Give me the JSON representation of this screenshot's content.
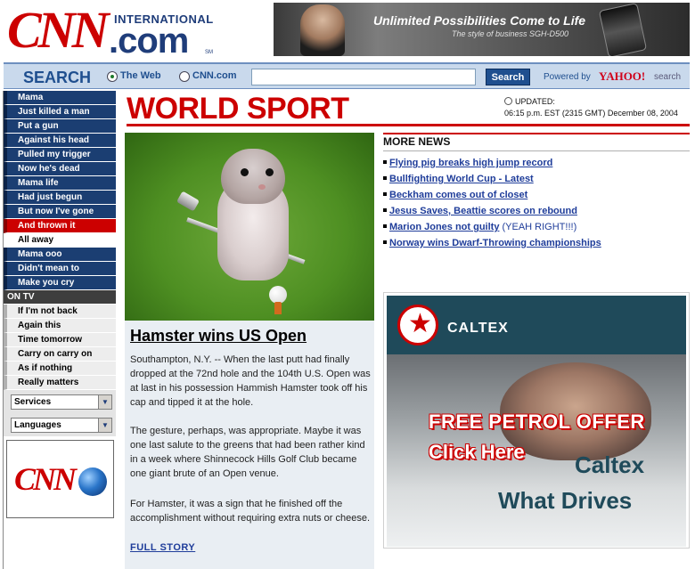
{
  "header": {
    "logo_cnn": "CNN",
    "logo_international": "INTERNATIONAL",
    "logo_dotcom": ".com",
    "logo_sm": "SM",
    "banner_title": "Unlimited Possibilities Come to Life",
    "banner_subtitle": "The style of business SGH-D500"
  },
  "search": {
    "label": "SEARCH",
    "option_web": "The Web",
    "option_cnn": "CNN.com",
    "input_value": "",
    "button_label": "Search",
    "powered_by": "Powered by",
    "yahoo": "YAHOO!",
    "yahoo_suffix": "search"
  },
  "nav": {
    "items": [
      "Mama",
      "Just killed a man",
      "Put a gun",
      "Against his head",
      "Pulled my trigger",
      "Now he's dead",
      "Mama life",
      "Had just begun",
      "But now I've gone",
      "And thrown it",
      "All away",
      "Mama ooo",
      "Didn't mean to",
      "Make you cry"
    ],
    "section_label": "ON TV",
    "tv_items": [
      "If I'm not back",
      "Again this",
      "Time tomorrow",
      "Carry on carry on",
      "As if nothing",
      "Really matters"
    ],
    "select_services": "Services",
    "select_languages": "Languages",
    "badge_cnn": "CNN"
  },
  "page": {
    "title": "WORLD SPORT",
    "updated_label": "UPDATED:",
    "updated_time": "06:15 p.m. EST (2315 GMT) December 08, 2004"
  },
  "story": {
    "headline": "Hamster wins US Open",
    "p1": "Southampton, N.Y. -- When the last putt had finally dropped at the 72nd hole and the 104th U.S. Open was at last in his possession Hammish Hamster took off his cap and tipped it at the hole.",
    "p2": "The gesture, perhaps, was appropriate. Maybe it was one last salute to the greens that had been rather kind in a week where Shinnecock Hills Golf Club became one giant brute of an Open venue.",
    "p3": "For Hamster, it was a sign that he finished off the accomplishment without requiring extra nuts or cheese.",
    "full_story": "FULL STORY"
  },
  "more_news": {
    "title": "MORE NEWS",
    "items": [
      {
        "link": "Flying pig breaks high jump record",
        "suffix": ""
      },
      {
        "link": "Bullfighting World Cup - Latest",
        "suffix": ""
      },
      {
        "link": "Beckham comes out of closet",
        "suffix": ""
      },
      {
        "link": "Jesus Saves, Beattie scores on rebound",
        "suffix": ""
      },
      {
        "link": "Marion Jones not guilty",
        "suffix": " (YEAH RIGHT!!!)"
      },
      {
        "link": "Norway wins Dwarf-Throwing championships",
        "suffix": ""
      }
    ]
  },
  "ad": {
    "brand": "CALTEX",
    "offer": "FREE PETROL OFFER",
    "click": "Click Here",
    "caltex": "Caltex",
    "what_drives": "What Drives"
  },
  "colors": {
    "cnn_red": "#cc0000",
    "nav_blue": "#1b3e72",
    "link_blue": "#1f3d9a"
  }
}
